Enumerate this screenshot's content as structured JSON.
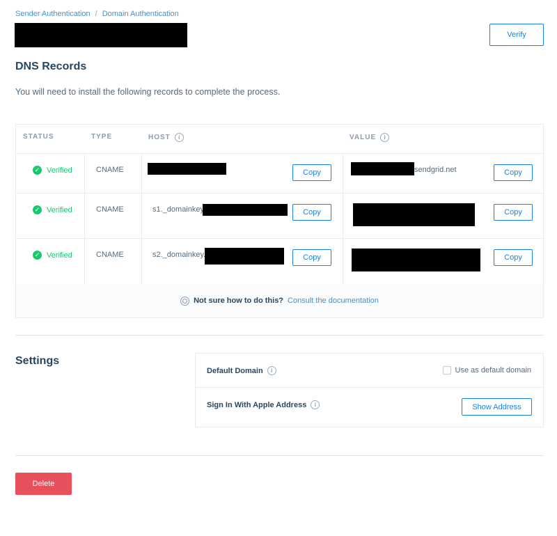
{
  "breadcrumb": {
    "items": [
      "Sender Authentication",
      "Domain Authentication"
    ],
    "separator": "/"
  },
  "header": {
    "verify_label": "Verify"
  },
  "dns": {
    "title": "DNS Records",
    "intro": "You will need to install the following records to complete the process.",
    "columns": [
      "STATUS",
      "TYPE",
      "HOST",
      "VALUE"
    ],
    "info_glyph": "i",
    "rows": [
      {
        "status": "Verified",
        "type": "CNAME",
        "host_prefix": "",
        "value_suffix": "sendgrid.net",
        "copy": "Copy"
      },
      {
        "status": "Verified",
        "type": "CNAME",
        "host_prefix": "s1._domainkey.",
        "value_suffix": "",
        "copy": "Copy"
      },
      {
        "status": "Verified",
        "type": "CNAME",
        "host_prefix": "s2._domainkey.",
        "value_suffix": "",
        "copy": "Copy"
      }
    ],
    "help": {
      "bold": "Not sure how to do this?",
      "link": "Consult the documentation"
    }
  },
  "settings": {
    "title": "Settings",
    "default_domain_label": "Default Domain",
    "default_domain_checkbox": "Use as default domain",
    "apple_label": "Sign In With Apple Address",
    "show_address": "Show Address"
  },
  "actions": {
    "delete_label": "Delete"
  },
  "colors": {
    "accent": "#1a82e2",
    "success": "#18c96e",
    "danger": "#e8505b"
  }
}
